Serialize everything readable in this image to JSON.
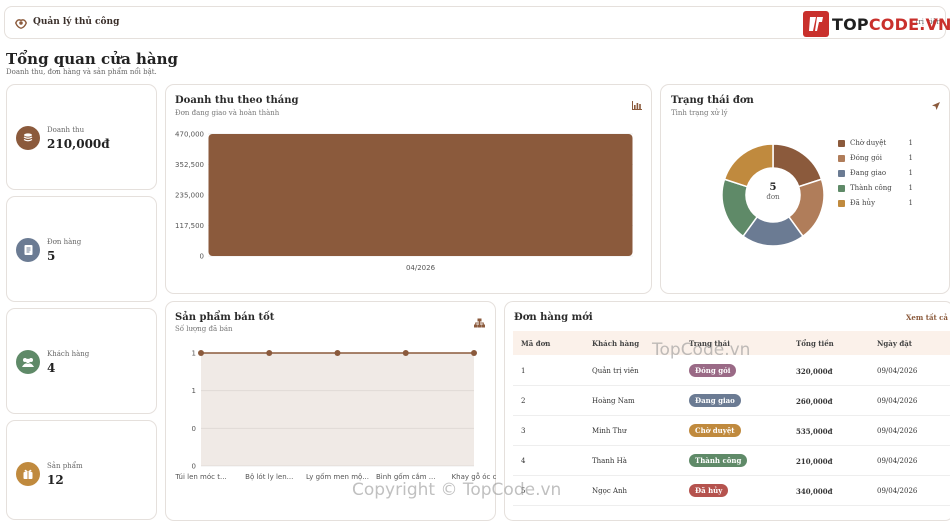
{
  "header": {
    "app_name": "Quản lý thủ công",
    "user_label": "trị viên"
  },
  "logo": {
    "prefix": "TOP",
    "suffix": "CODE.VN"
  },
  "page": {
    "title": "Tổng quan cửa hàng",
    "subtitle": "Doanh thu, đơn hàng và sản phẩm nổi bật."
  },
  "stats": [
    {
      "icon": "coins-icon",
      "label": "Doanh thu",
      "value": "210,000đ",
      "color": "#8b5a3c"
    },
    {
      "icon": "receipt-icon",
      "label": "Đơn hàng",
      "value": "5",
      "color": "#6b7b93"
    },
    {
      "icon": "users-icon",
      "label": "Khách hàng",
      "value": "4",
      "color": "#5f8a68"
    },
    {
      "icon": "gift-icon",
      "label": "Sản phẩm",
      "value": "12",
      "color": "#c08a3e"
    }
  ],
  "revenue": {
    "title": "Doanh thu theo tháng",
    "subtitle": "Đơn đang giao và hoàn thành",
    "icon": "bar-chart-icon"
  },
  "status_card": {
    "title": "Trạng thái đơn",
    "subtitle": "Tình trạng xử lý",
    "icon": "send-icon",
    "center_value": "5",
    "center_label": "đơn"
  },
  "best": {
    "title": "Sản phẩm bán tốt",
    "subtitle": "Số lượng đã bán",
    "icon": "sitemap-icon"
  },
  "orders": {
    "title": "Đơn hàng mới",
    "view_all": "Xem tất cả",
    "columns": [
      "Mã đơn",
      "Khách hàng",
      "Trạng thái",
      "Tổng tiền",
      "Ngày đặt"
    ],
    "rows": [
      {
        "id": "1",
        "customer": "Quản trị viên",
        "status": "Đóng gói",
        "status_color": "#9a6a86",
        "total": "320,000đ",
        "date": "09/04/2026"
      },
      {
        "id": "2",
        "customer": "Hoàng Nam",
        "status": "Đang giao",
        "status_color": "#6b7b93",
        "total": "260,000đ",
        "date": "09/04/2026"
      },
      {
        "id": "3",
        "customer": "Minh Thư",
        "status": "Chờ duyệt",
        "status_color": "#c08a3e",
        "total": "535,000đ",
        "date": "09/04/2026"
      },
      {
        "id": "4",
        "customer": "Thanh Hà",
        "status": "Thành công",
        "status_color": "#5f8a68",
        "total": "210,000đ",
        "date": "09/04/2026"
      },
      {
        "id": "5",
        "customer": "Ngọc Anh",
        "status": "Đã hủy",
        "status_color": "#b5534e",
        "total": "340,000đ",
        "date": "09/04/2026"
      }
    ]
  },
  "watermarks": {
    "center": "TopCode.vn",
    "bottom": "Copyright © TopCode.vn"
  },
  "chart_data": [
    {
      "type": "bar",
      "categories": [
        "04/2026"
      ],
      "values": [
        470000
      ],
      "yticks": [
        "470,000",
        "352,500",
        "235,000",
        "117,500",
        "0"
      ],
      "ylim": [
        0,
        470000
      ],
      "color": "#8b5a3c"
    },
    {
      "type": "pie",
      "labels": [
        "Chờ duyệt",
        "Đóng gói",
        "Đang giao",
        "Thành công",
        "Đã hủy"
      ],
      "values": [
        1,
        1,
        1,
        1,
        1
      ],
      "colors": [
        "#8b5a3c",
        "#b07d5a",
        "#6b7b93",
        "#5f8a68",
        "#c08a3e"
      ],
      "legend": "right"
    },
    {
      "type": "area",
      "categories": [
        "Túi len móc t...",
        "Bộ lót ly len...",
        "Ly gốm men mộ...",
        "Bình gốm cắm ...",
        "Khay gỗ óc c"
      ],
      "values": [
        1,
        1,
        1,
        1,
        1
      ],
      "yticks": [
        "1",
        "1",
        "0",
        "0"
      ],
      "color": "#8b5a3c"
    }
  ]
}
